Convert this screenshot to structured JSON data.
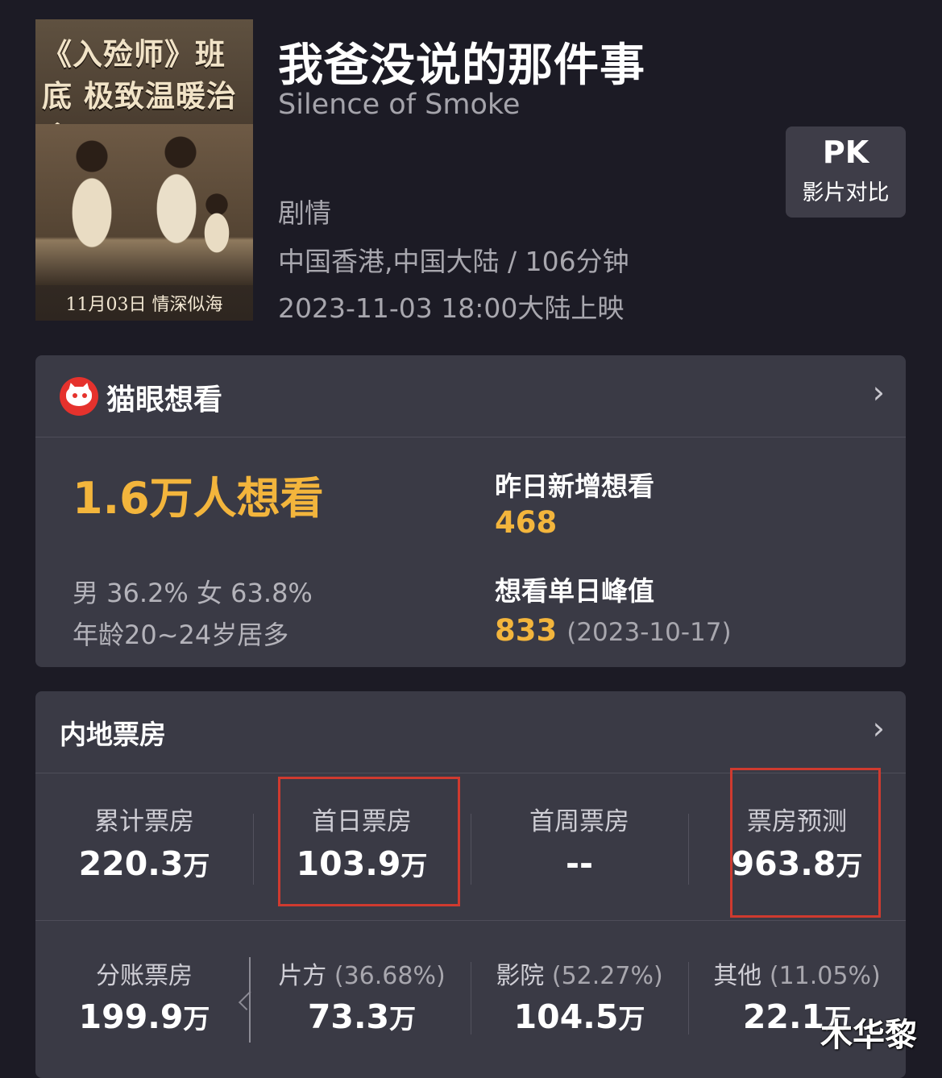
{
  "poster": {
    "tagline": "《入殓师》班底 极致温暖治愈",
    "date": "11月03日 情深似海"
  },
  "movie": {
    "title_cn": "我爸没说的那件事",
    "title_en": "Silence of Smoke",
    "genre": "剧情",
    "region_duration": "中国香港,中国大陆 / 106分钟",
    "release": "2023-11-03 18:00大陆上映"
  },
  "pk": {
    "top": "PK",
    "sub": "影片对比"
  },
  "wish": {
    "header": "猫眼想看",
    "total": "1.6万人想看",
    "gender": "男 36.2% 女 63.8%",
    "age": "年龄20~24岁居多",
    "new_label": "昨日新增想看",
    "new_value": "468",
    "peak_label": "想看单日峰值",
    "peak_value": "833",
    "peak_date": "(2023-10-17)"
  },
  "box_office": {
    "header": "内地票房",
    "row1": [
      {
        "label": "累计票房",
        "value": "220.3",
        "unit": "万"
      },
      {
        "label": "首日票房",
        "value": "103.9",
        "unit": "万"
      },
      {
        "label": "首周票房",
        "value": "--",
        "unit": ""
      },
      {
        "label": "票房预测",
        "value": "963.8",
        "unit": "万"
      }
    ],
    "row2": [
      {
        "label": "分账票房",
        "pct": "",
        "value": "199.9",
        "unit": "万"
      },
      {
        "label": "片方 ",
        "pct": "(36.68%)",
        "value": "73.3",
        "unit": "万"
      },
      {
        "label": "影院 ",
        "pct": "(52.27%)",
        "value": "104.5",
        "unit": "万"
      },
      {
        "label": "其他 ",
        "pct": "(11.05%)",
        "value": "22.1",
        "unit": "万"
      }
    ]
  },
  "icons": {
    "chevron": "›"
  },
  "watermark": "木华黎",
  "colors": {
    "accent": "#f3b53c",
    "highlight": "#cf3a2f",
    "background": "#1c1b25",
    "card": "#3a3a45"
  }
}
